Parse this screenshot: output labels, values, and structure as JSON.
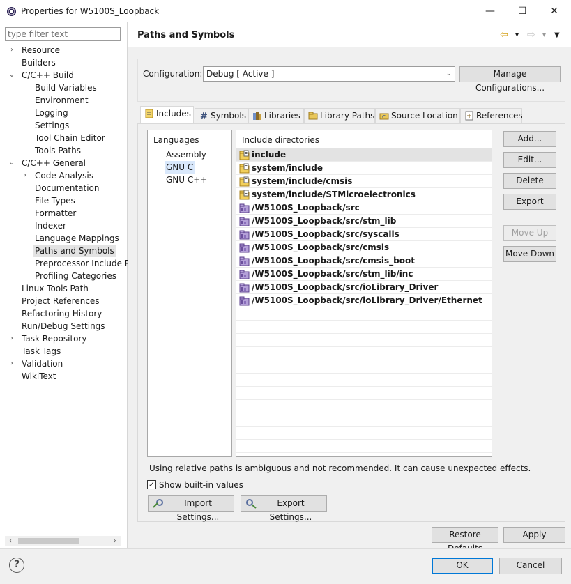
{
  "window": {
    "title": "Properties for W5100S_Loopback",
    "minimize": "—",
    "maximize": "☐",
    "close": "✕"
  },
  "filter": {
    "placeholder": "type filter text"
  },
  "tree": [
    {
      "label": "Resource",
      "chevron": "›"
    },
    {
      "label": "Builders",
      "chevron": ""
    },
    {
      "label": "C/C++ Build",
      "chevron": "⌄"
    },
    {
      "label": "Build Variables",
      "chevron": ""
    },
    {
      "label": "Environment",
      "chevron": ""
    },
    {
      "label": "Logging",
      "chevron": ""
    },
    {
      "label": "Settings",
      "chevron": ""
    },
    {
      "label": "Tool Chain Editor",
      "chevron": ""
    },
    {
      "label": "Tools Paths",
      "chevron": ""
    },
    {
      "label": "C/C++ General",
      "chevron": "⌄"
    },
    {
      "label": "Code Analysis",
      "chevron": "›"
    },
    {
      "label": "Documentation",
      "chevron": ""
    },
    {
      "label": "File Types",
      "chevron": ""
    },
    {
      "label": "Formatter",
      "chevron": ""
    },
    {
      "label": "Indexer",
      "chevron": ""
    },
    {
      "label": "Language Mappings",
      "chevron": ""
    },
    {
      "label": "Paths and Symbols",
      "chevron": ""
    },
    {
      "label": "Preprocessor Include P",
      "chevron": ""
    },
    {
      "label": "Profiling Categories",
      "chevron": ""
    },
    {
      "label": "Linux Tools Path",
      "chevron": ""
    },
    {
      "label": "Project References",
      "chevron": ""
    },
    {
      "label": "Refactoring History",
      "chevron": ""
    },
    {
      "label": "Run/Debug Settings",
      "chevron": ""
    },
    {
      "label": "Task Repository",
      "chevron": "›"
    },
    {
      "label": "Task Tags",
      "chevron": ""
    },
    {
      "label": "Validation",
      "chevron": "›"
    },
    {
      "label": "WikiText",
      "chevron": ""
    }
  ],
  "scroll": {
    "left": "‹",
    "right": "›"
  },
  "page": {
    "title": "Paths and Symbols"
  },
  "nav": {
    "back": "⇦",
    "forward": "⇨",
    "menu": "▼",
    "dropdown": "▾"
  },
  "config": {
    "label": "Configuration:",
    "value": "Debug  [ Active ]",
    "manage": "Manage Configurations..."
  },
  "tabs": [
    {
      "label": "Includes",
      "icon": "includes-icon"
    },
    {
      "label": "Symbols",
      "icon": "hash-icon"
    },
    {
      "label": "Libraries",
      "icon": "libraries-icon"
    },
    {
      "label": "Library Paths",
      "icon": "library-paths-icon"
    },
    {
      "label": "Source Location",
      "icon": "source-location-icon"
    },
    {
      "label": "References",
      "icon": "references-icon"
    }
  ],
  "languages": {
    "header": "Languages",
    "items": [
      "Assembly",
      "GNU C",
      "GNU C++"
    ]
  },
  "dirs": {
    "header": "Include directories",
    "items": [
      {
        "path": "include",
        "kind": "folder"
      },
      {
        "path": "system/include",
        "kind": "folder"
      },
      {
        "path": "system/include/cmsis",
        "kind": "folder"
      },
      {
        "path": "system/include/STMicroelectronics",
        "kind": "folder"
      },
      {
        "path": "/W5100S_Loopback/src",
        "kind": "workspace"
      },
      {
        "path": "/W5100S_Loopback/src/stm_lib",
        "kind": "workspace"
      },
      {
        "path": "/W5100S_Loopback/src/syscalls",
        "kind": "workspace"
      },
      {
        "path": "/W5100S_Loopback/src/cmsis",
        "kind": "workspace"
      },
      {
        "path": "/W5100S_Loopback/src/cmsis_boot",
        "kind": "workspace"
      },
      {
        "path": "/W5100S_Loopback/src/stm_lib/inc",
        "kind": "workspace"
      },
      {
        "path": "/W5100S_Loopback/src/ioLibrary_Driver",
        "kind": "workspace"
      },
      {
        "path": "/W5100S_Loopback/src/ioLibrary_Driver/Ethernet",
        "kind": "workspace"
      }
    ]
  },
  "side_buttons": {
    "add": "Add...",
    "edit": "Edit...",
    "delete": "Delete",
    "export": "Export",
    "move_up": "Move Up",
    "move_down": "Move Down"
  },
  "warning": "Using relative paths is ambiguous and not recommended. It can cause unexpected effects.",
  "show_builtin": {
    "label": "Show built-in values",
    "mark": "✓"
  },
  "import_settings": "Import Settings...",
  "export_settings": "Export Settings...",
  "restore_defaults": "Restore Defaults",
  "apply": "Apply",
  "ok": "OK",
  "cancel": "Cancel",
  "help": "?"
}
